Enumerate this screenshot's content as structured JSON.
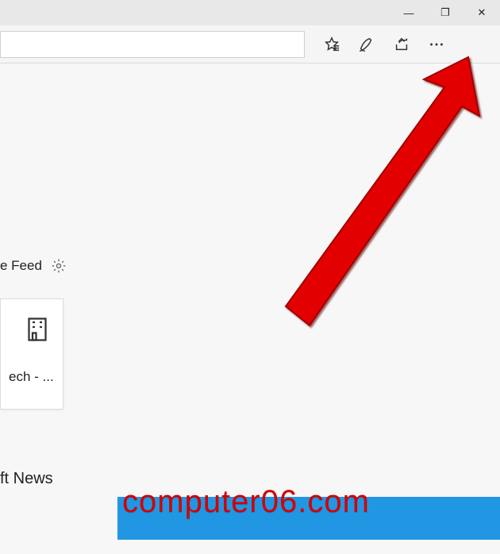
{
  "window": {
    "minimize_glyph": "—",
    "restore_glyph": "❐",
    "close_glyph": "✕"
  },
  "toolbar": {
    "address_value": "",
    "favorites_name": "favorites-icon",
    "notes_name": "web-notes-icon",
    "share_name": "share-icon",
    "more_name": "more-icon"
  },
  "content": {
    "feed_label": "e Feed",
    "tile_label": "ech - ...",
    "news_label": "ft News"
  },
  "watermark": "computer06.com"
}
